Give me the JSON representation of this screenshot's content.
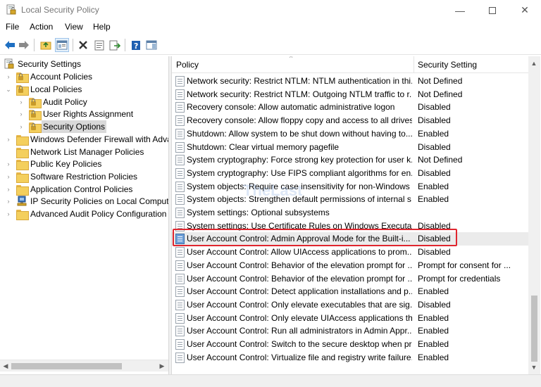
{
  "window": {
    "title": "Local Security Policy",
    "minimize_glyph": "—",
    "close_glyph": "✕"
  },
  "menu": [
    "File",
    "Action",
    "View",
    "Help"
  ],
  "toolbar": {
    "icons": [
      "back-arrow-icon",
      "forward-arrow-icon",
      "up-folder-icon",
      "show-hide-tree-icon",
      "delete-icon",
      "properties-icon",
      "export-list-icon",
      "help-icon",
      "action-pane-icon"
    ]
  },
  "tree": {
    "items": [
      {
        "label": "Security Settings",
        "expander": "",
        "level": 0
      },
      {
        "label": "Account Policies",
        "expander": "›",
        "level": 1
      },
      {
        "label": "Local Policies",
        "expander": "⌄",
        "level": 1
      },
      {
        "label": "Audit Policy",
        "expander": "›",
        "level": 2
      },
      {
        "label": "User Rights Assignment",
        "expander": "›",
        "level": 2
      },
      {
        "label": "Security Options",
        "expander": "›",
        "level": 2,
        "selected": true
      },
      {
        "label": "Windows Defender Firewall with Adva",
        "expander": "›",
        "level": 1
      },
      {
        "label": "Network List Manager Policies",
        "expander": "",
        "level": 1
      },
      {
        "label": "Public Key Policies",
        "expander": "›",
        "level": 1
      },
      {
        "label": "Software Restriction Policies",
        "expander": "›",
        "level": 1
      },
      {
        "label": "Application Control Policies",
        "expander": "›",
        "level": 1
      },
      {
        "label": "IP Security Policies on Local Compute",
        "expander": "›",
        "level": 1
      },
      {
        "label": "Advanced Audit Policy Configuration",
        "expander": "›",
        "level": 1
      }
    ]
  },
  "list": {
    "columns": {
      "policy": "Policy",
      "setting": "Security Setting"
    },
    "rows": [
      {
        "policy": "Network security: Restrict NTLM: NTLM authentication in thi...",
        "setting": "Not Defined"
      },
      {
        "policy": "Network security: Restrict NTLM: Outgoing NTLM traffic to r...",
        "setting": "Not Defined"
      },
      {
        "policy": "Recovery console: Allow automatic administrative logon",
        "setting": "Disabled"
      },
      {
        "policy": "Recovery console: Allow floppy copy and access to all drives...",
        "setting": "Disabled"
      },
      {
        "policy": "Shutdown: Allow system to be shut down without having to...",
        "setting": "Enabled"
      },
      {
        "policy": "Shutdown: Clear virtual memory pagefile",
        "setting": "Disabled"
      },
      {
        "policy": "System cryptography: Force strong key protection for user k...",
        "setting": "Not Defined"
      },
      {
        "policy": "System cryptography: Use FIPS compliant algorithms for en...",
        "setting": "Disabled"
      },
      {
        "policy": "System objects: Require case insensitivity for non-Windows ...",
        "setting": "Enabled"
      },
      {
        "policy": "System objects: Strengthen default permissions of internal s...",
        "setting": "Enabled"
      },
      {
        "policy": "System settings: Optional subsystems",
        "setting": ""
      },
      {
        "policy": "System settings: Use Certificate Rules on Windows Executab...",
        "setting": "Disabled"
      },
      {
        "policy": "User Account Control: Admin Approval Mode for the Built-i...",
        "setting": "Disabled",
        "highlighted": true
      },
      {
        "policy": "User Account Control: Allow UIAccess applications to prom...",
        "setting": "Disabled"
      },
      {
        "policy": "User Account Control: Behavior of the elevation prompt for ...",
        "setting": "Prompt for consent for ..."
      },
      {
        "policy": "User Account Control: Behavior of the elevation prompt for ...",
        "setting": "Prompt for credentials"
      },
      {
        "policy": "User Account Control: Detect application installations and p...",
        "setting": "Enabled"
      },
      {
        "policy": "User Account Control: Only elevate executables that are sig...",
        "setting": "Disabled"
      },
      {
        "policy": "User Account Control: Only elevate UIAccess applications th...",
        "setting": "Enabled"
      },
      {
        "policy": "User Account Control: Run all administrators in Admin Appr...",
        "setting": "Enabled"
      },
      {
        "policy": "User Account Control: Switch to the secure desktop when pr...",
        "setting": "Enabled"
      },
      {
        "policy": "User Account Control: Virtualize file and registry write failure...",
        "setting": "Enabled"
      }
    ]
  },
  "watermark": "TheLast",
  "colors": {
    "highlight_border": "#e0262e",
    "selected_row": "#ebebeb",
    "toolbar_blue": "#1e6fc2"
  }
}
